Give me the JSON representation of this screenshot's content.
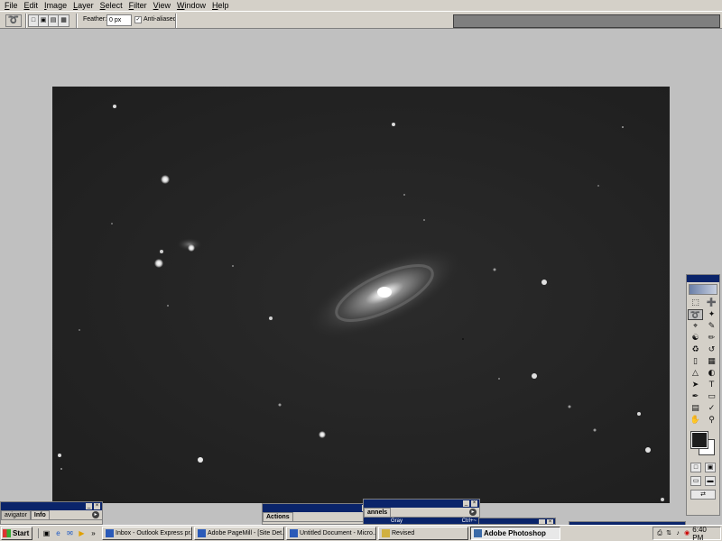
{
  "menu": [
    "File",
    "Edit",
    "Image",
    "Layer",
    "Select",
    "Filter",
    "View",
    "Window",
    "Help"
  ],
  "options_bar": {
    "feather_label": "Feather:",
    "feather_value": "0 px",
    "antialias_label": "Anti-aliased",
    "antialias_checked": true
  },
  "panels": {
    "navigator_tab": "avigator",
    "info_tab": "Info",
    "actions_tab": "Actions",
    "channels_tab": "annels",
    "channels_row_name": "Gray",
    "channels_row_shortcut": "Ctrl+~"
  },
  "taskbar": {
    "start": "Start",
    "tasks": [
      "Inbox - Outlook Express pr...",
      "Adobe PageMill - [Site Det...",
      "Untitled Document - Micro...",
      "Revised",
      "Adobe Photoshop"
    ],
    "active_task": 4,
    "clock": "6:40 PM"
  },
  "icons": {
    "lasso": "lasso-icon",
    "start_flag": "windows-flag-icon"
  },
  "colors": {
    "titlebar": "#0a246a",
    "chrome": "#d4d0c8",
    "canvas": "#232323"
  }
}
